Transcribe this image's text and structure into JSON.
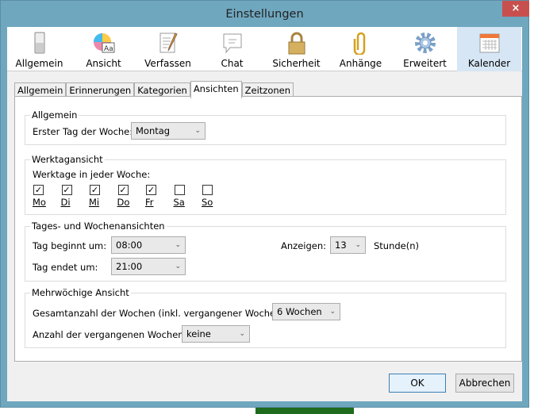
{
  "window": {
    "title": "Einstellungen",
    "close": "×"
  },
  "toolbar": [
    {
      "label": "Allgemein",
      "icon": "switch-icon"
    },
    {
      "label": "Ansicht",
      "icon": "color-font-icon"
    },
    {
      "label": "Verfassen",
      "icon": "compose-pencil-icon"
    },
    {
      "label": "Chat",
      "icon": "chat-bubble-icon"
    },
    {
      "label": "Sicherheit",
      "icon": "padlock-icon"
    },
    {
      "label": "Anhänge",
      "icon": "paperclip-icon"
    },
    {
      "label": "Erweitert",
      "icon": "gear-icon"
    },
    {
      "label": "Kalender",
      "icon": "calendar-icon",
      "selected": true
    }
  ],
  "tabs": [
    "Allgemein",
    "Erinnerungen",
    "Kategorien",
    "Ansichten",
    "Zeitzonen"
  ],
  "general": {
    "legend": "Allgemein",
    "first_day_label": "Erster Tag der Woche:",
    "first_day_value": "Montag"
  },
  "workweek": {
    "legend": "Werktagansicht",
    "label": "Werktage in jeder Woche:",
    "days": [
      {
        "label": "Mo",
        "checked": true
      },
      {
        "label": "Di",
        "checked": true
      },
      {
        "label": "Mi",
        "checked": true
      },
      {
        "label": "Do",
        "checked": true
      },
      {
        "label": "Fr",
        "checked": true
      },
      {
        "label": "Sa",
        "checked": false
      },
      {
        "label": "So",
        "checked": false
      }
    ]
  },
  "dayweek": {
    "legend": "Tages- und Wochenansichten",
    "start_label": "Tag beginnt um:",
    "start_value": "08:00",
    "end_label": "Tag endet um:",
    "end_value": "21:00",
    "show_label": "Anzeigen:",
    "show_value": "13",
    "hours_label": "Stunde(n)"
  },
  "multiweek": {
    "legend": "Mehrwöchige Ansicht",
    "total_label": "Gesamtanzahl der Wochen (inkl. vergangener Wochen):",
    "total_value": "6 Wochen",
    "past_label": "Anzahl der vergangenen Wochen:",
    "past_value": "keine"
  },
  "buttons": {
    "ok": "OK",
    "cancel": "Abbrechen"
  },
  "arrow": "⌄"
}
